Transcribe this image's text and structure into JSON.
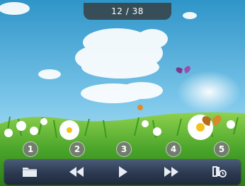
{
  "viewer": {
    "counter_text": "12 / 38"
  },
  "toolbar": {
    "buttons": [
      {
        "marker": "1",
        "icon": "folder-icon"
      },
      {
        "marker": "2",
        "icon": "rewind-icon"
      },
      {
        "marker": "3",
        "icon": "play-icon"
      },
      {
        "marker": "4",
        "icon": "fast-forward-icon"
      },
      {
        "marker": "5",
        "icon": "slideshow-settings-icon"
      }
    ]
  },
  "colors": {
    "sky_top": "#2f95c8",
    "sky_bottom": "#bfe6f4",
    "grass": "#4aa52a",
    "toolbar": "#2c3950"
  }
}
